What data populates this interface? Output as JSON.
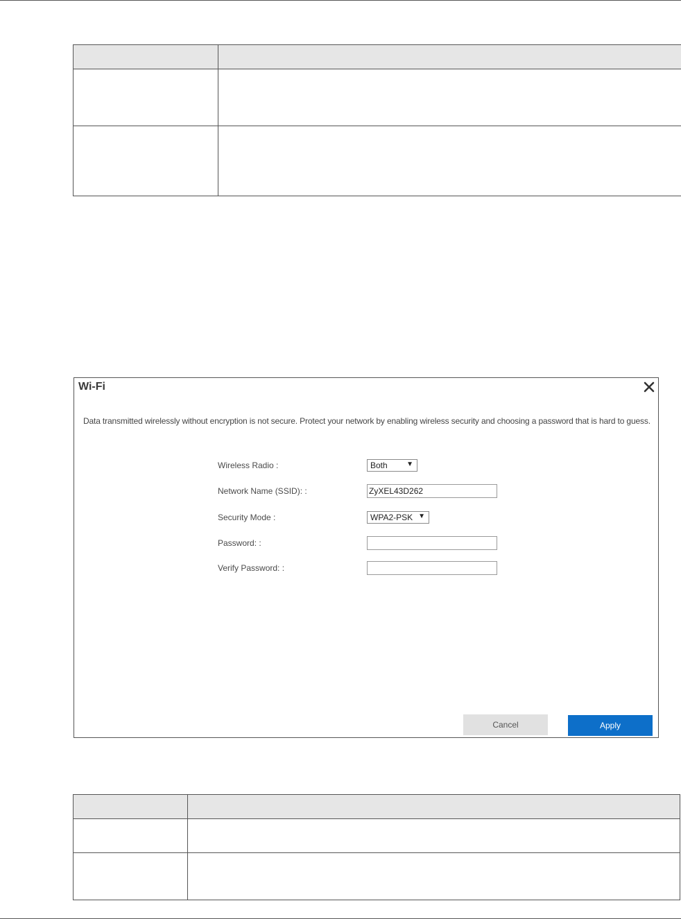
{
  "dialog": {
    "title": "Wi-Fi",
    "notice": "Data transmitted wirelessly without encryption is not secure. Protect your network by enabling wireless security and choosing a password that is hard to guess.",
    "fields": {
      "wireless_radio": {
        "label": "Wireless Radio :",
        "value": "Both"
      },
      "ssid": {
        "label": "Network Name (SSID): :",
        "value": "ZyXEL43D262"
      },
      "security_mode": {
        "label": "Security Mode :",
        "value": "WPA2-PSK"
      },
      "password": {
        "label": "Password: :",
        "value": ""
      },
      "verify_password": {
        "label": "Verify Password: :",
        "value": ""
      }
    },
    "buttons": {
      "cancel": "Cancel",
      "apply": "Apply"
    },
    "icons": {
      "close": "close-icon",
      "dropdown": "chevron-down-icon"
    }
  },
  "colors": {
    "apply_button": "#0d6fc9",
    "cancel_button": "#e1e1e1",
    "table_header": "#e6e6e6"
  }
}
